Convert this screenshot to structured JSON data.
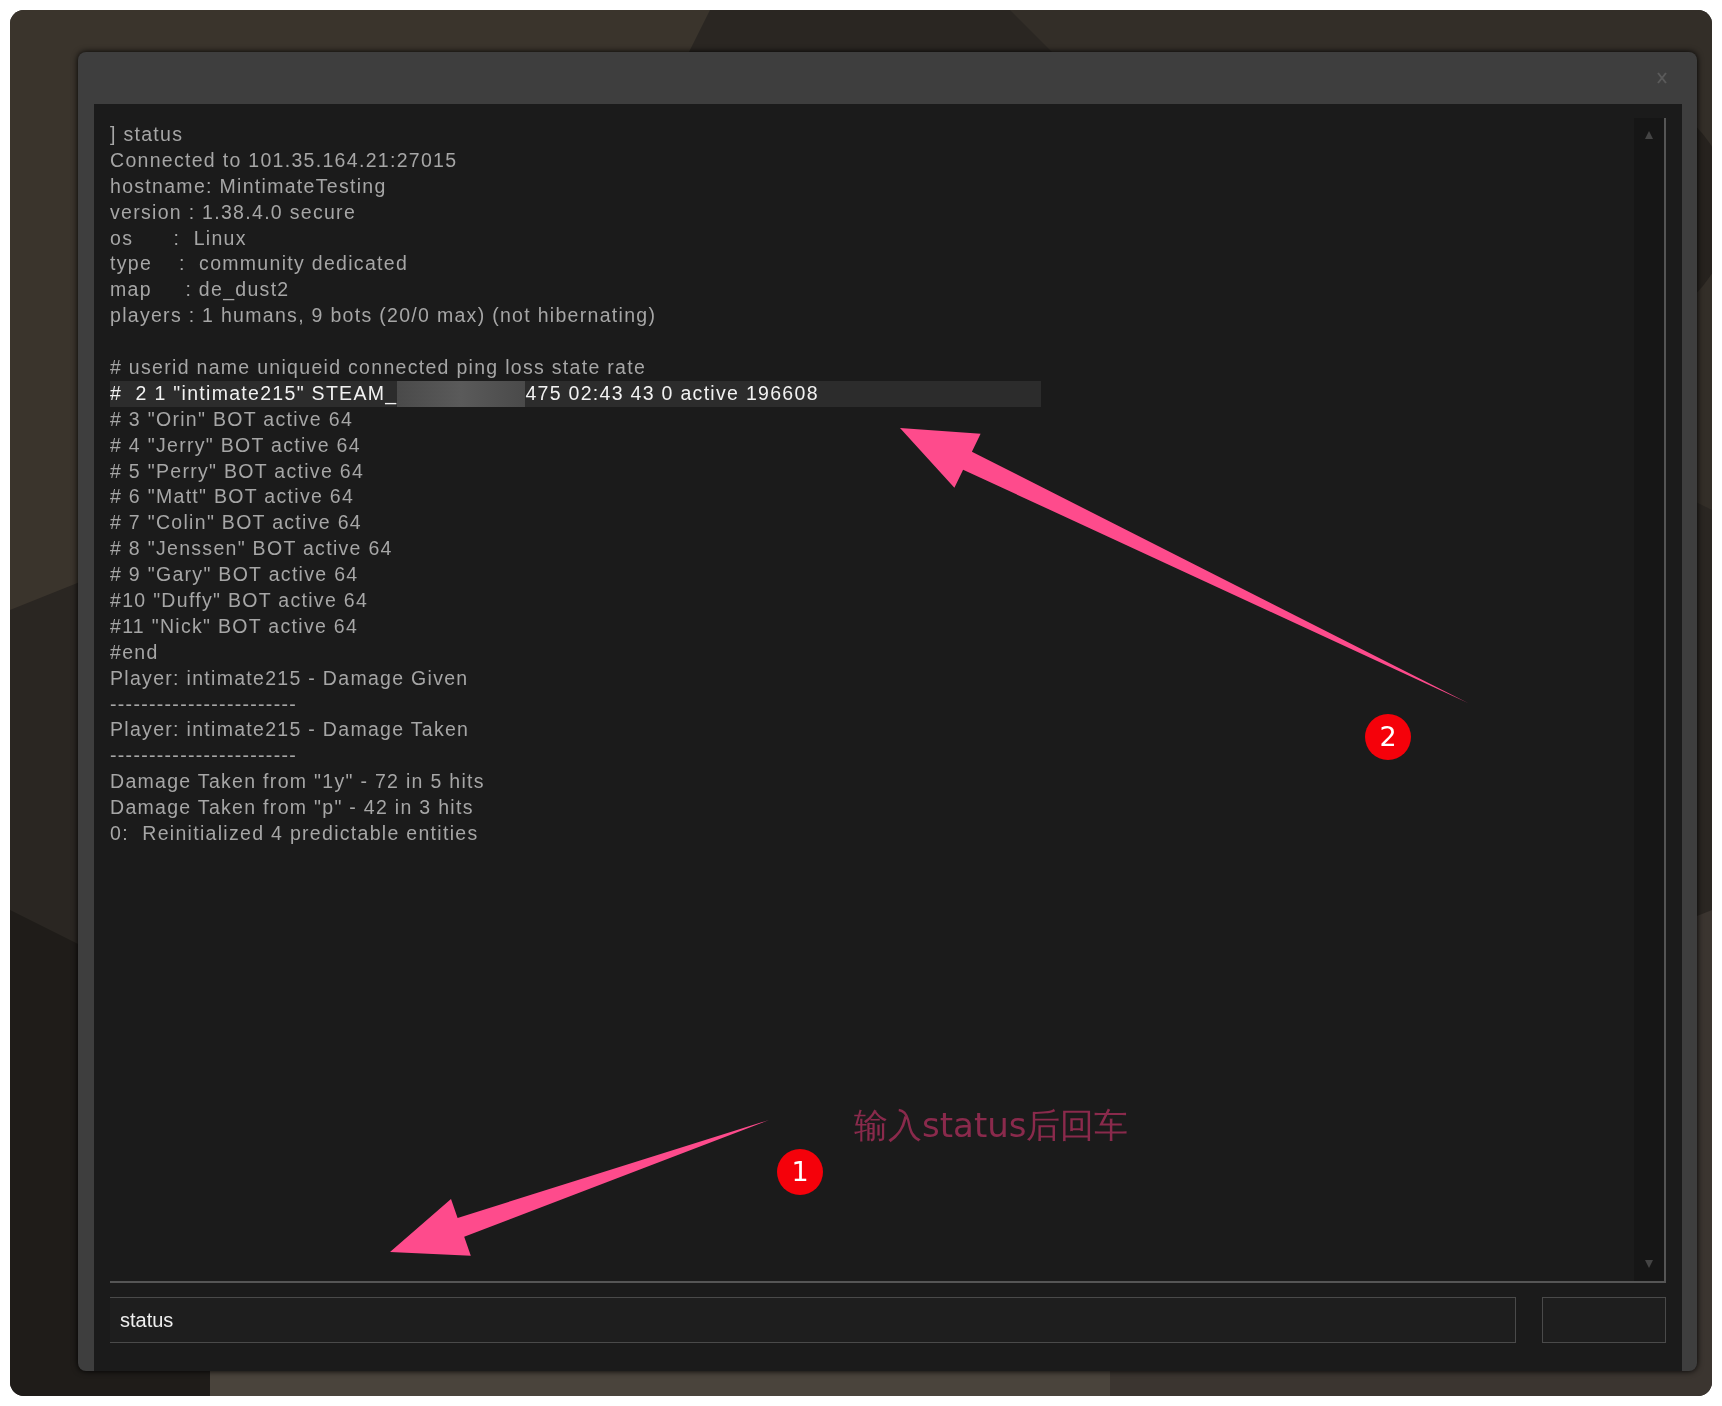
{
  "console": {
    "log": [
      {
        "kind": "text",
        "text": "] status",
        "highlighted": false
      },
      {
        "kind": "text",
        "text": "Connected to 101.35.164.21:27015",
        "highlighted": false
      },
      {
        "kind": "text",
        "text": "hostname: MintimateTesting",
        "highlighted": false
      },
      {
        "kind": "text",
        "text": "version : 1.38.4.0 secure",
        "highlighted": false
      },
      {
        "kind": "text",
        "text": "os      :  Linux",
        "highlighted": false
      },
      {
        "kind": "text",
        "text": "type    :  community dedicated",
        "highlighted": false
      },
      {
        "kind": "text",
        "text": "map     : de_dust2",
        "highlighted": false
      },
      {
        "kind": "text",
        "text": "players : 1 humans, 9 bots (20/0 max) (not hibernating)",
        "highlighted": false
      },
      {
        "kind": "blank"
      },
      {
        "kind": "text",
        "text": "# userid name uniqueid connected ping loss state rate",
        "highlighted": false
      },
      {
        "kind": "redacted",
        "text": "#  2 1 \"intimate215\" STEAM_",
        "text_after": "475 02:43 43 0 active 196608",
        "highlighted": true
      },
      {
        "kind": "text",
        "text": "# 3 \"Orin\" BOT active 64",
        "highlighted": false
      },
      {
        "kind": "text",
        "text": "# 4 \"Jerry\" BOT active 64",
        "highlighted": false
      },
      {
        "kind": "text",
        "text": "# 5 \"Perry\" BOT active 64",
        "highlighted": false
      },
      {
        "kind": "text",
        "text": "# 6 \"Matt\" BOT active 64",
        "highlighted": false
      },
      {
        "kind": "text",
        "text": "# 7 \"Colin\" BOT active 64",
        "highlighted": false
      },
      {
        "kind": "text",
        "text": "# 8 \"Jenssen\" BOT active 64",
        "highlighted": false
      },
      {
        "kind": "text",
        "text": "# 9 \"Gary\" BOT active 64",
        "highlighted": false
      },
      {
        "kind": "text",
        "text": "#10 \"Duffy\" BOT active 64",
        "highlighted": false
      },
      {
        "kind": "text",
        "text": "#11 \"Nick\" BOT active 64",
        "highlighted": false
      },
      {
        "kind": "text",
        "text": "#end",
        "highlighted": false
      },
      {
        "kind": "text",
        "text": "Player: intimate215 - Damage Given",
        "highlighted": false
      },
      {
        "kind": "text",
        "text": "------------------------",
        "highlighted": false
      },
      {
        "kind": "text",
        "text": "Player: intimate215 - Damage Taken",
        "highlighted": false
      },
      {
        "kind": "text",
        "text": "------------------------",
        "highlighted": false
      },
      {
        "kind": "text",
        "text": "Damage Taken from \"1y\" - 72 in 5 hits",
        "highlighted": false
      },
      {
        "kind": "text",
        "text": "Damage Taken from \"p\" - 42 in 3 hits",
        "highlighted": false
      },
      {
        "kind": "text",
        "text": "0:  Reinitialized 4 predictable entities",
        "highlighted": false
      }
    ],
    "input": {
      "value": "status"
    }
  },
  "annotations": {
    "steps": [
      {
        "number": "1"
      },
      {
        "number": "2"
      }
    ],
    "note": "输入status后回车"
  }
}
